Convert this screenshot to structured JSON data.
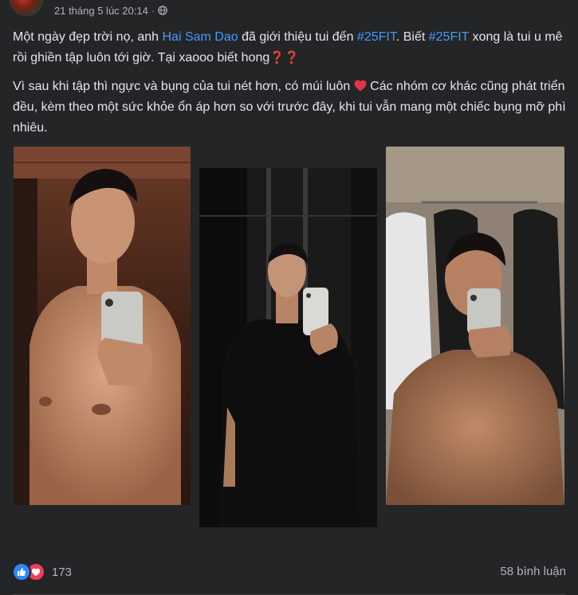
{
  "post": {
    "timestamp": "21 tháng 5 lúc 20:14",
    "separator": "·",
    "audience_icon": "globe-icon",
    "paragraph1": {
      "t1": "Một ngày đẹp trời nọ, anh ",
      "mention": "Hai Sam Dao",
      "t2": " đã giới thiệu tui đến ",
      "hashtag1": "#25FIT",
      "t3": ". Biết ",
      "hashtag2": "#25FIT",
      "t4": " xong là tui u mê rồi ghiền tập luôn tới giờ. Tại xaooo biết hong",
      "emoji": "❓❓"
    },
    "paragraph2": {
      "t1": "Vì sau khi tập thì ngực và bụng của tui nét hơn, có múi luôn ",
      "heart_icon": "red-heart-emoji",
      "t2": " Các nhóm cơ khác cũng phát triển đều, kèm theo một sức khỏe ổn áp hơn so với trước đây, khi tui vẫn mang một chiếc bụng mỡ phì nhiêu."
    },
    "photos": [
      "mirror-selfie-shirtless-locker",
      "mirror-selfie-black-shirt",
      "mirror-selfie-shirtless-towels"
    ]
  },
  "footer": {
    "reaction_icons": [
      "like-icon",
      "love-icon"
    ],
    "reaction_count": "173",
    "comments_label": "58 bình luận"
  },
  "colors": {
    "background": "#242526",
    "text": "#e4e6eb",
    "secondary_text": "#b0b3b8",
    "link": "#4599ff",
    "like_blue": "#2d88ff",
    "love_red": "#f33e58"
  }
}
